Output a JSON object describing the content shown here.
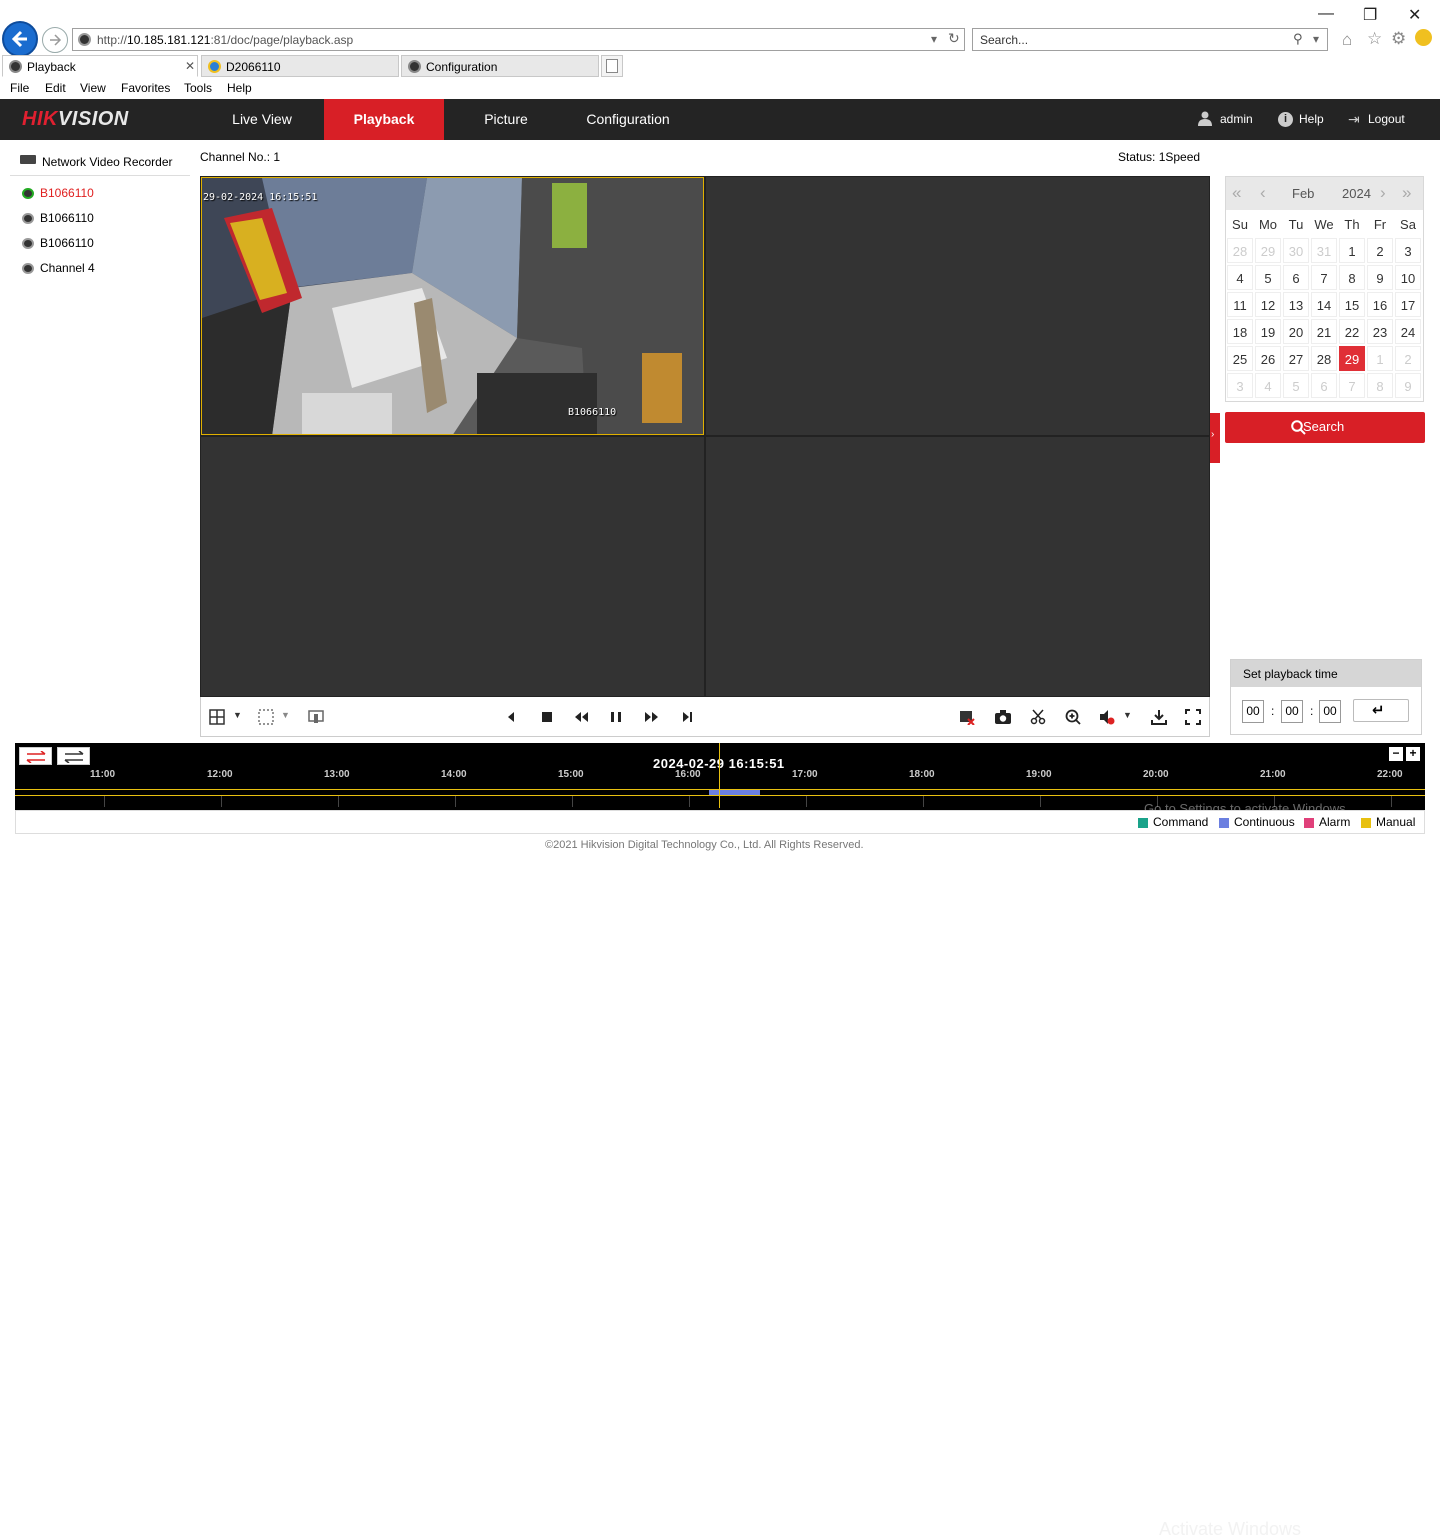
{
  "browser": {
    "address_prefix": "http://",
    "address_host": "10.185.181.121",
    "address_rest": ":81/doc/page/playback.asp",
    "search_placeholder": "Search...",
    "tabs": [
      {
        "label": "Playback"
      },
      {
        "label": "D2066110"
      },
      {
        "label": "Configuration"
      }
    ],
    "menu": [
      "File",
      "Edit",
      "View",
      "Favorites",
      "Tools",
      "Help"
    ]
  },
  "header": {
    "logo_red": "HIK",
    "logo_white": "VISION",
    "nav": [
      "Live View",
      "Playback",
      "Picture",
      "Configuration"
    ],
    "user": "admin",
    "help": "Help",
    "logout": "Logout"
  },
  "left_panel": {
    "root": "Network Video Recorder",
    "channels": [
      "B1066110",
      "B1066110",
      "B1066110",
      "Channel 4"
    ]
  },
  "main": {
    "channel_label": "Channel No.: 1",
    "status_label": "Status: 1Speed",
    "osd_time": "29-02-2024 16:15:51",
    "osd_name": "B1066110"
  },
  "calendar": {
    "month": "Feb",
    "year": "2024",
    "dow": [
      "Su",
      "Mo",
      "Tu",
      "We",
      "Th",
      "Fr",
      "Sa"
    ],
    "weeks": [
      [
        "28",
        "29",
        "30",
        "31",
        "1",
        "2",
        "3"
      ],
      [
        "4",
        "5",
        "6",
        "7",
        "8",
        "9",
        "10"
      ],
      [
        "11",
        "12",
        "13",
        "14",
        "15",
        "16",
        "17"
      ],
      [
        "18",
        "19",
        "20",
        "21",
        "22",
        "23",
        "24"
      ],
      [
        "25",
        "26",
        "27",
        "28",
        "29",
        "1",
        "2"
      ],
      [
        "3",
        "4",
        "5",
        "6",
        "7",
        "8",
        "9"
      ]
    ],
    "selected": "29"
  },
  "search_button": "Search",
  "playback_time": {
    "title": "Set playback time",
    "hh": "00",
    "mm": "00",
    "ss": "00",
    "sep": ":"
  },
  "timeline": {
    "current": "2024-02-29 16:15:51",
    "ticks": [
      "11:00",
      "12:00",
      "13:00",
      "14:00",
      "15:00",
      "16:00",
      "17:00",
      "18:00",
      "19:00",
      "20:00",
      "21:00",
      "22:00"
    ]
  },
  "legend": [
    {
      "label": "Command",
      "color": "#1aa38a"
    },
    {
      "label": "Continuous",
      "color": "#6b7fe0"
    },
    {
      "label": "Alarm",
      "color": "#e0407a"
    },
    {
      "label": "Manual",
      "color": "#e8c010"
    }
  ],
  "watermark": {
    "line1": "Activate Windows",
    "line2": "Go to Settings to activate Windows."
  },
  "footer": "©2021 Hikvision Digital Technology Co., Ltd. All Rights Reserved."
}
